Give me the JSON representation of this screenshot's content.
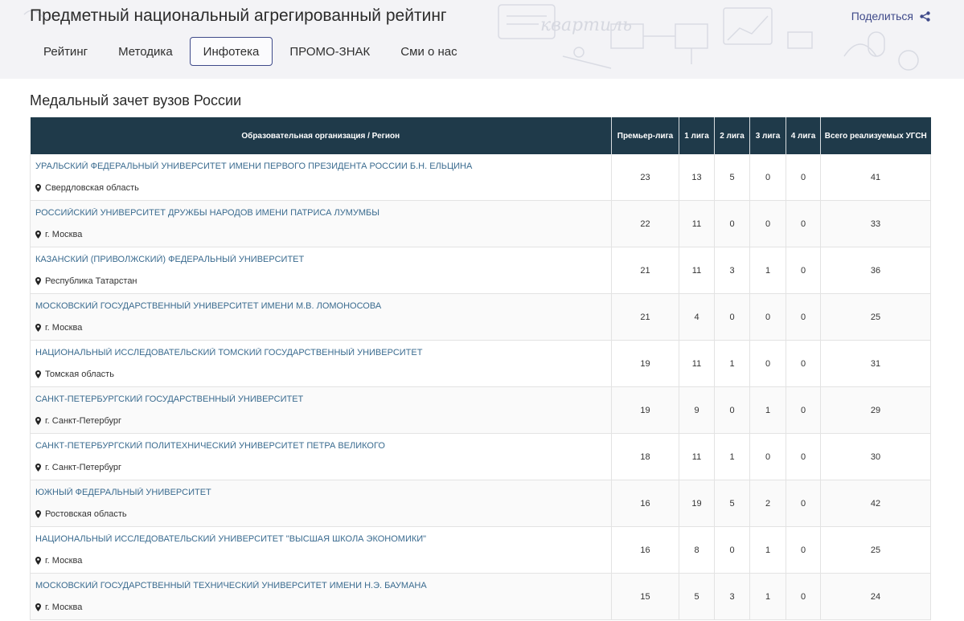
{
  "header": {
    "title": "Предметный национальный агрегированный рейтинг",
    "share_label": "Поделиться",
    "share_icon": "share-icon",
    "background_text": "квартиль"
  },
  "nav": {
    "items": [
      {
        "label": "Рейтинг",
        "active": false
      },
      {
        "label": "Методика",
        "active": false
      },
      {
        "label": "Инфотека",
        "active": true
      },
      {
        "label": "ПРОМО-ЗНАК",
        "active": false
      },
      {
        "label": "Сми о нас",
        "active": false
      }
    ]
  },
  "page": {
    "heading": "Медальный зачет вузов России"
  },
  "table": {
    "columns": [
      "Образовательная организация / Регион",
      "Премьер-лига",
      "1 лига",
      "2 лига",
      "3 лига",
      "4 лига",
      "Всего реализуемых УГСН"
    ],
    "rows": [
      {
        "name": "УРАЛЬСКИЙ ФЕДЕРАЛЬНЫЙ УНИВЕРСИТЕТ ИМЕНИ ПЕРВОГО ПРЕЗИДЕНТА РОССИИ Б.Н. ЕЛЬЦИНА",
        "region": "Свердловская область",
        "premier": "23",
        "l1": "13",
        "l2": "5",
        "l3": "0",
        "l4": "0",
        "total": "41"
      },
      {
        "name": "РОССИЙСКИЙ УНИВЕРСИТЕТ ДРУЖБЫ НАРОДОВ ИМЕНИ ПАТРИСА ЛУМУМБЫ",
        "region": "г. Москва",
        "premier": "22",
        "l1": "11",
        "l2": "0",
        "l3": "0",
        "l4": "0",
        "total": "33"
      },
      {
        "name": "КАЗАНСКИЙ (ПРИВОЛЖСКИЙ) ФЕДЕРАЛЬНЫЙ УНИВЕРСИТЕТ",
        "region": "Республика Татарстан",
        "premier": "21",
        "l1": "11",
        "l2": "3",
        "l3": "1",
        "l4": "0",
        "total": "36"
      },
      {
        "name": "МОСКОВСКИЙ ГОСУДАРСТВЕННЫЙ УНИВЕРСИТЕТ ИМЕНИ М.В. ЛОМОНОСОВА",
        "region": "г. Москва",
        "premier": "21",
        "l1": "4",
        "l2": "0",
        "l3": "0",
        "l4": "0",
        "total": "25"
      },
      {
        "name": "НАЦИОНАЛЬНЫЙ ИССЛЕДОВАТЕЛЬСКИЙ ТОМСКИЙ ГОСУДАРСТВЕННЫЙ УНИВЕРСИТЕТ",
        "region": "Томская область",
        "premier": "19",
        "l1": "11",
        "l2": "1",
        "l3": "0",
        "l4": "0",
        "total": "31"
      },
      {
        "name": "САНКТ-ПЕТЕРБУРГСКИЙ ГОСУДАРСТВЕННЫЙ УНИВЕРСИТЕТ",
        "region": "г. Санкт-Петербург",
        "premier": "19",
        "l1": "9",
        "l2": "0",
        "l3": "1",
        "l4": "0",
        "total": "29"
      },
      {
        "name": "САНКТ-ПЕТЕРБУРГСКИЙ ПОЛИТЕХНИЧЕСКИЙ УНИВЕРСИТЕТ ПЕТРА ВЕЛИКОГО",
        "region": "г. Санкт-Петербург",
        "premier": "18",
        "l1": "11",
        "l2": "1",
        "l3": "0",
        "l4": "0",
        "total": "30"
      },
      {
        "name": "ЮЖНЫЙ ФЕДЕРАЛЬНЫЙ УНИВЕРСИТЕТ",
        "region": "Ростовская область",
        "premier": "16",
        "l1": "19",
        "l2": "5",
        "l3": "2",
        "l4": "0",
        "total": "42"
      },
      {
        "name": "НАЦИОНАЛЬНЫЙ ИССЛЕДОВАТЕЛЬСКИЙ УНИВЕРСИТЕТ \"ВЫСШАЯ ШКОЛА ЭКОНОМИКИ\"",
        "region": "г. Москва",
        "premier": "16",
        "l1": "8",
        "l2": "0",
        "l3": "1",
        "l4": "0",
        "total": "25"
      },
      {
        "name": "МОСКОВСКИЙ ГОСУДАРСТВЕННЫЙ ТЕХНИЧЕСКИЙ УНИВЕРСИТЕТ ИМЕНИ Н.Э. БАУМАНА",
        "region": "г. Москва",
        "premier": "15",
        "l1": "5",
        "l2": "3",
        "l3": "1",
        "l4": "0",
        "total": "24"
      }
    ],
    "region_icon": "map-marker-icon"
  },
  "colors": {
    "header_bg": "#f3f3f6",
    "table_header_bg": "#1f3a4a",
    "link": "#3a6b8f",
    "accent": "#3f4a8a"
  }
}
